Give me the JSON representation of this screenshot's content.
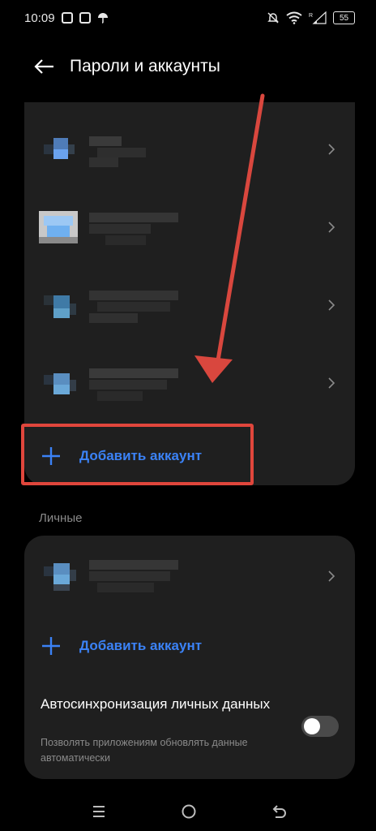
{
  "status_bar": {
    "time": "10:09",
    "battery": "55",
    "icons": [
      "photo-icon",
      "app-icon",
      "umbrella-icon",
      "mute-icon",
      "wifi-icon",
      "signal-icon",
      "battery-icon"
    ]
  },
  "header": {
    "title": "Пароли и аккаунты",
    "back_icon": "arrow-left-icon"
  },
  "accounts_group": {
    "add_label": "Добавить аккаунт",
    "rows": [
      {
        "icon_color": "#5f98e0"
      },
      {
        "icon_color": "#7fb4ef"
      },
      {
        "icon_color": "#5fa0c8"
      },
      {
        "icon_color": "#6aa8d8"
      }
    ]
  },
  "personal_group": {
    "section_label": "Личные",
    "add_label": "Добавить аккаунт",
    "sync_title": "Автосинхронизация личных данных",
    "sync_subtitle": "Позволять приложениям обновлять данные автоматически",
    "sync_enabled": false
  },
  "nav_bar": {
    "icons": [
      "menu-icon",
      "home-icon",
      "back-icon"
    ]
  },
  "colors": {
    "accent": "#3b82f6",
    "card": "#1f1f1f",
    "highlight": "#e0463c",
    "background": "#000000"
  }
}
